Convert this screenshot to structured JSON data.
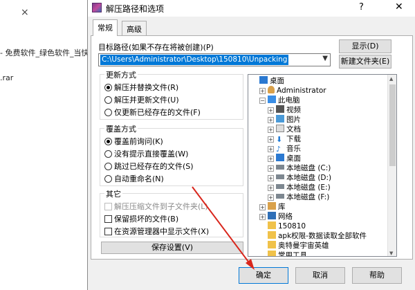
{
  "background_window": {
    "close_glyph": "×",
    "item_text": "- 免费软件_绿色软件_当快软",
    "file_text": ".rar"
  },
  "dialog": {
    "title": "解压路径和选项",
    "help_glyph": "?",
    "close_glyph": "✕",
    "tabs": [
      {
        "label": "常规",
        "active": true
      },
      {
        "label": "高级",
        "active": false
      }
    ],
    "target_path_label": "目标路径(如果不存在将被创建)(P)",
    "target_path_value": "C:\\Users\\Administrator\\Desktop\\150810\\Unpacking",
    "show_button": "显示(D)",
    "new_folder_button": "新建文件夹(E)",
    "update_mode": {
      "title": "更新方式",
      "options": [
        {
          "label": "解压并替换文件(R)",
          "selected": true
        },
        {
          "label": "解压并更新文件(U)",
          "selected": false
        },
        {
          "label": "仅更新已经存在的文件(F)",
          "selected": false
        }
      ]
    },
    "overwrite_mode": {
      "title": "覆盖方式",
      "options": [
        {
          "label": "覆盖前询问(K)",
          "selected": true
        },
        {
          "label": "没有提示直接覆盖(W)",
          "selected": false
        },
        {
          "label": "跳过已经存在的文件(S)",
          "selected": false
        },
        {
          "label": "自动重命名(N)",
          "selected": false
        }
      ]
    },
    "misc": {
      "title": "其它",
      "options": [
        {
          "label": "解压压缩文件到子文件夹(L)",
          "checked": false,
          "disabled": true
        },
        {
          "label": "保留损坏的文件(B)",
          "checked": false,
          "disabled": false
        },
        {
          "label": "在资源管理器中显示文件(X)",
          "checked": false,
          "disabled": false
        }
      ]
    },
    "save_settings_button": "保存设置(V)",
    "tree": {
      "items": [
        {
          "label": "桌面",
          "icon": "desktop-icon",
          "expander": ""
        },
        {
          "label": "Administrator",
          "icon": "user-folder-icon",
          "expander": "+"
        },
        {
          "label": "此电脑",
          "icon": "computer-icon",
          "expander": "−"
        },
        {
          "label": "视频",
          "icon": "video-folder-icon",
          "expander": "+"
        },
        {
          "label": "图片",
          "icon": "pictures-folder-icon",
          "expander": "+"
        },
        {
          "label": "文档",
          "icon": "documents-folder-icon",
          "expander": "+"
        },
        {
          "label": "下载",
          "icon": "downloads-folder-icon",
          "expander": "+"
        },
        {
          "label": "音乐",
          "icon": "music-folder-icon",
          "expander": "+"
        },
        {
          "label": "桌面",
          "icon": "desktop-folder-icon",
          "expander": "+"
        },
        {
          "label": "本地磁盘 (C:)",
          "icon": "drive-icon",
          "expander": "+"
        },
        {
          "label": "本地磁盘 (D:)",
          "icon": "drive-icon",
          "expander": "+"
        },
        {
          "label": "本地磁盘 (E:)",
          "icon": "drive-icon",
          "expander": "+"
        },
        {
          "label": "本地磁盘 (F:)",
          "icon": "drive-icon",
          "expander": "+"
        },
        {
          "label": "库",
          "icon": "library-icon",
          "expander": "+"
        },
        {
          "label": "网络",
          "icon": "network-icon",
          "expander": "+"
        },
        {
          "label": "150810",
          "icon": "folder-icon",
          "expander": ""
        },
        {
          "label": "apk权限-数据读取全部软件",
          "icon": "folder-icon",
          "expander": ""
        },
        {
          "label": "奥特曼宇宙英雄",
          "icon": "folder-icon",
          "expander": ""
        },
        {
          "label": "常用工具",
          "icon": "folder-icon",
          "expander": ""
        }
      ]
    },
    "ok_button": "确定",
    "cancel_button": "取消",
    "help_button": "帮助"
  },
  "colors": {
    "selection": "#0078d7",
    "arrow": "#d9261c"
  }
}
